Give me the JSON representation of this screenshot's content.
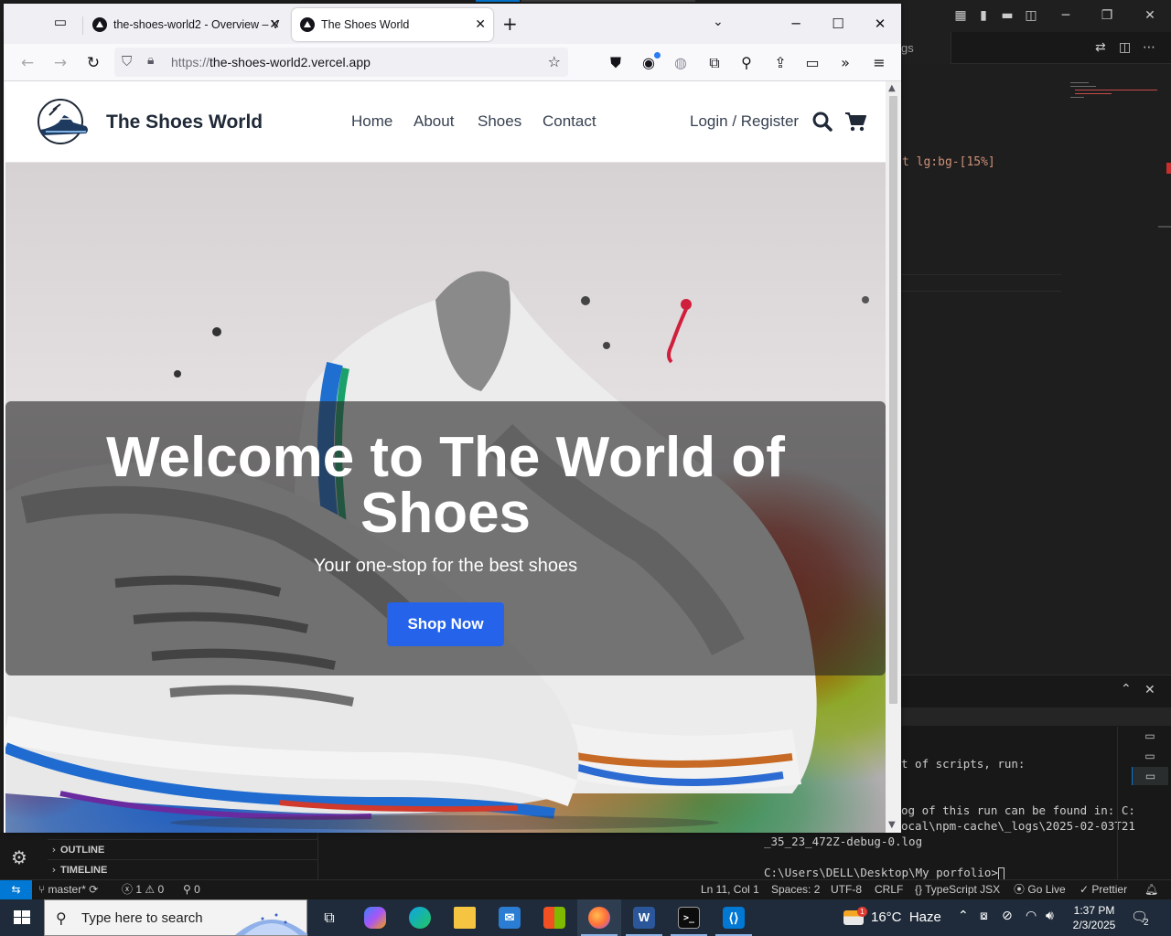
{
  "browser": {
    "tabs": [
      {
        "title": "the-shoes-world2 - Overview – V",
        "active": false
      },
      {
        "title": "The Shoes World",
        "active": true
      }
    ],
    "url_scheme": "https://",
    "url_host": "the-shoes-world2.vercel.app"
  },
  "site": {
    "name": "The Shoes World",
    "nav": [
      "Home",
      "About",
      "Shoes",
      "Contact"
    ],
    "login": "Login / Register",
    "hero_title": "Welcome to The World of Shoes",
    "hero_subtitle": "Your one-stop for the best shoes",
    "cta": "Shop Now",
    "accent_color": "#2563eb"
  },
  "vscode": {
    "editor_tab_fragment": "gs",
    "code_fragment": "t lg:bg-[15%]",
    "terminal_lines": [
      "t of scripts, run:",
      "og of this run can be found in: C:",
      "ocal\\npm-cache\\_logs\\2025-02-03T21",
      "_35_23_472Z-debug-0.log",
      "C:\\Users\\DELL\\Desktop\\My porfolio>"
    ],
    "sidebar_sections": [
      "OUTLINE",
      "TIMELINE"
    ],
    "status": {
      "branch": "master*",
      "errors": "1",
      "warnings": "0",
      "ports": "0",
      "position": "Ln 11, Col 1",
      "spaces": "Spaces: 2",
      "encoding": "UTF-8",
      "eol": "CRLF",
      "language": "TypeScript JSX",
      "golive": "Go Live",
      "prettier": "Prettier"
    }
  },
  "taskbar": {
    "search_placeholder": "Type here to search",
    "weather": "16°C  Haze",
    "weather_badge": "1",
    "time": "1:37 PM",
    "date": "2/3/2025",
    "notifications": "2"
  }
}
